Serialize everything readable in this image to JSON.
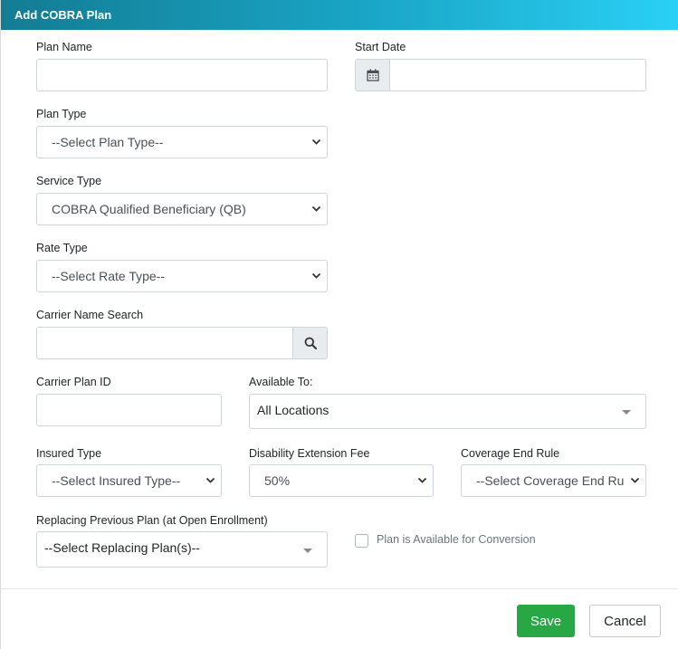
{
  "modal": {
    "title": "Add COBRA Plan"
  },
  "fields": {
    "plan_name": {
      "label": "Plan Name",
      "value": ""
    },
    "start_date": {
      "label": "Start Date",
      "value": ""
    },
    "plan_type": {
      "label": "Plan Type",
      "selected": "--Select Plan Type--"
    },
    "service_type": {
      "label": "Service Type",
      "selected": "COBRA Qualified Beneficiary (QB)"
    },
    "rate_type": {
      "label": "Rate Type",
      "selected": "--Select Rate Type--"
    },
    "carrier_name_search": {
      "label": "Carrier Name Search",
      "value": ""
    },
    "carrier_plan_id": {
      "label": "Carrier Plan ID",
      "value": ""
    },
    "available_to": {
      "label": "Available To:",
      "selected": "All Locations"
    },
    "insured_type": {
      "label": "Insured Type",
      "selected": "--Select Insured Type--"
    },
    "disability_extension_fee": {
      "label": "Disability Extension Fee",
      "selected": "50%"
    },
    "coverage_end_rule": {
      "label": "Coverage End Rule",
      "selected": "--Select Coverage End Ru"
    },
    "replacing_previous_plan": {
      "label": "Replacing Previous Plan (at Open Enrollment)",
      "selected": "--Select Replacing Plan(s)--"
    },
    "conversion": {
      "label": "Plan is Available for Conversion",
      "checked": false
    }
  },
  "buttons": {
    "save": "Save",
    "cancel": "Cancel"
  },
  "icons": {
    "calendar": "calendar-icon",
    "search": "search-icon",
    "chevron": "chevron-down-icon"
  },
  "colors": {
    "header_start": "#137c93",
    "header_end": "#2ad0f5",
    "save": "#28a745"
  }
}
